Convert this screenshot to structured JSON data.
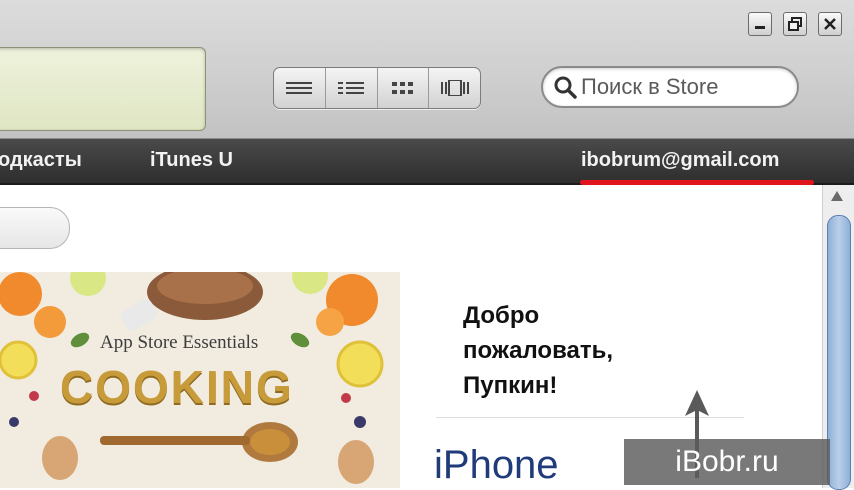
{
  "window": {
    "minimize_icon": "minimize-icon",
    "maximize_icon": "restore-icon",
    "close_icon": "close-icon"
  },
  "toolbar": {
    "view_buttons": [
      "list-view-icon",
      "album-list-view-icon",
      "grid-view-icon",
      "cover-flow-view-icon"
    ],
    "search": {
      "placeholder": "Поиск в Store",
      "icon": "search-icon"
    }
  },
  "nav": {
    "items": [
      "одкасты",
      "iTunes U"
    ],
    "account": "ibobrum@gmail.com",
    "account_highlight_color": "#e0151b"
  },
  "banner": {
    "subtitle": "App Store Essentials",
    "title": "COOKING"
  },
  "welcome": {
    "line1": "Добро",
    "line2": "пожаловать,",
    "line3": "Пупкин!"
  },
  "section_heading": "iPhone",
  "watermark": "iBobr.ru"
}
